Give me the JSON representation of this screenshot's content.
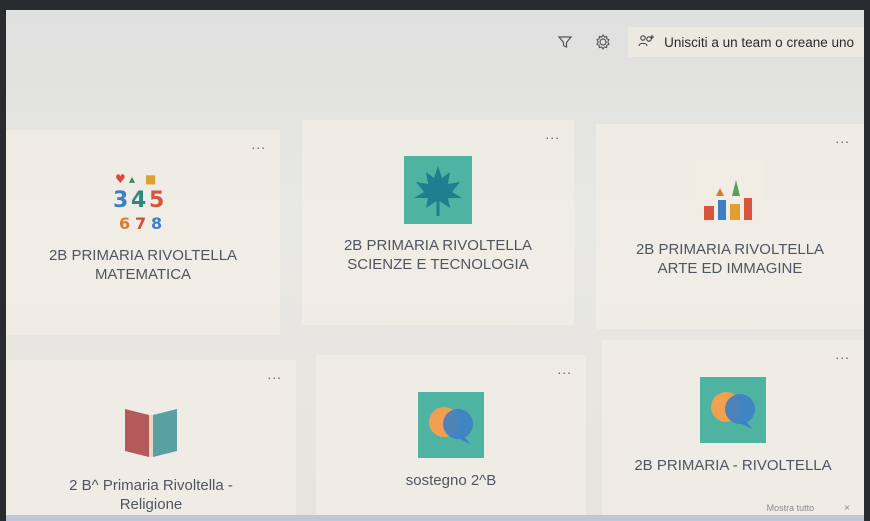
{
  "toolbar": {
    "filter_icon": "filter-icon",
    "settings_icon": "gear-icon",
    "join_icon": "team-add-icon",
    "join_label": "Unisciti a un team o creane uno"
  },
  "teams": [
    {
      "name": "2B PRIMARIA RIVOLTELLA\nMATEMATICA",
      "more": "...",
      "thumb": "numbers-icon"
    },
    {
      "name": "2B PRIMARIA RIVOLTELLA\nSCIENZE E TECNOLOGIA",
      "more": "...",
      "thumb": "leaf-icon"
    },
    {
      "name": "2B PRIMARIA RIVOLTELLA\nARTE ED IMMAGINE",
      "more": "...",
      "thumb": "art-icon"
    },
    {
      "name": "2 B^ Primaria Rivoltella -\nReligione",
      "more": "...",
      "thumb": "book-icon"
    },
    {
      "name": "sostegno 2^B",
      "more": "...",
      "thumb": "chat-bubbles-icon"
    },
    {
      "name": "2B PRIMARIA - RIVOLTELLA",
      "more": "...",
      "thumb": "chat-bubbles-icon"
    }
  ],
  "footer": {
    "mostra_label": "Mostra tutto",
    "close_label": "×"
  },
  "colors": {
    "accent": "#2f8f8f",
    "text": "#4f5660",
    "button_bg": "#ece9e1"
  }
}
